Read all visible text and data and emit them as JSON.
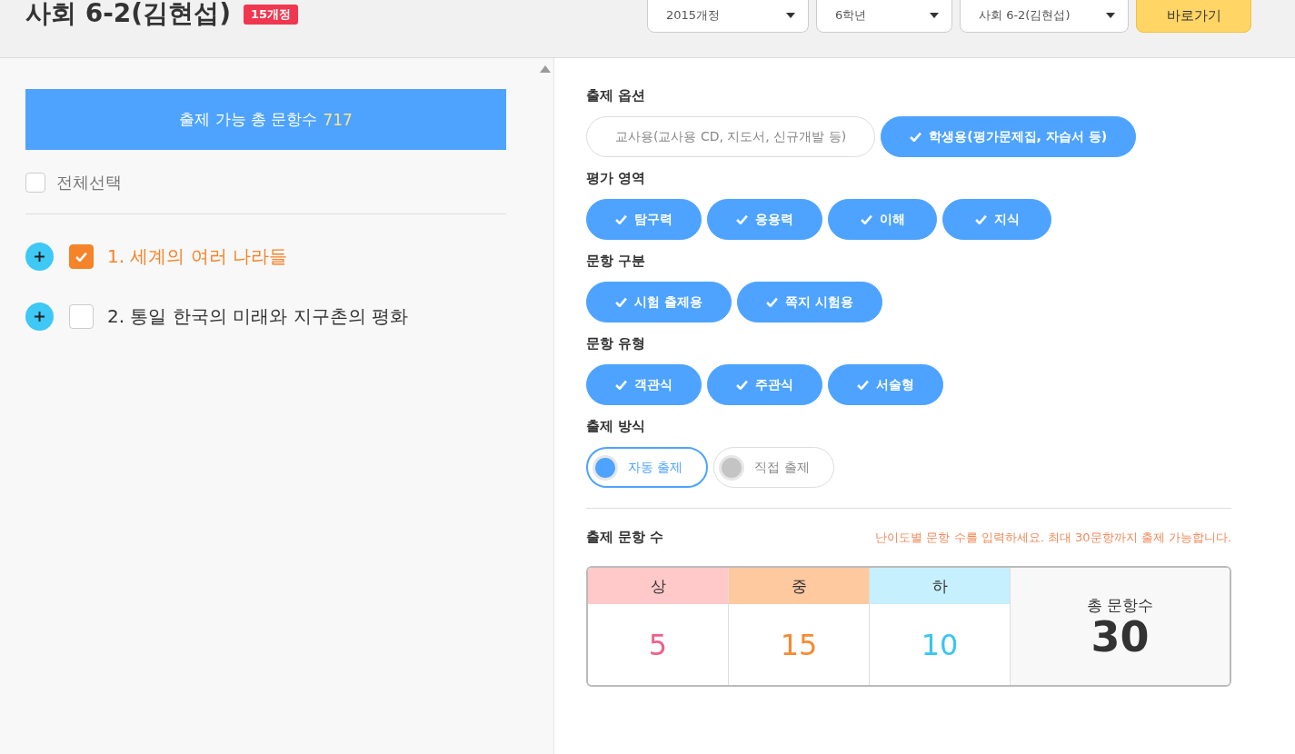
{
  "header": {
    "title": "사회 6-2(김현섭)",
    "badge": "15개정",
    "selects": [
      {
        "value": "2015개정"
      },
      {
        "value": "6학년"
      },
      {
        "value": "사회 6-2(김현섭)"
      }
    ],
    "go_button": "바로가기"
  },
  "left": {
    "total_banner": {
      "label": "출제 가능 총 문항수",
      "count": "717"
    },
    "select_all": {
      "label": "전체선택",
      "checked": false
    },
    "units": [
      {
        "label": "1. 세계의 여러 나라들",
        "checked": true
      },
      {
        "label": "2. 통일 한국의 미래와 지구촌의 평화",
        "checked": false
      }
    ]
  },
  "right": {
    "groups": [
      {
        "title": "출제 옵션",
        "kind": "chips",
        "options": [
          {
            "label": "교사용(교사용 CD, 지도서, 신규개발 등)",
            "selected": false
          },
          {
            "label": "학생용(평가문제집, 자습서 등)",
            "selected": true
          }
        ]
      },
      {
        "title": "평가 영역",
        "kind": "chips",
        "options": [
          {
            "label": "탐구력",
            "selected": true
          },
          {
            "label": "응용력",
            "selected": true
          },
          {
            "label": "이해",
            "selected": true
          },
          {
            "label": "지식",
            "selected": true
          }
        ]
      },
      {
        "title": "문항 구분",
        "kind": "chips",
        "options": [
          {
            "label": "시험 출제용",
            "selected": true
          },
          {
            "label": "쪽지 시험용",
            "selected": true
          }
        ]
      },
      {
        "title": "문항 유형",
        "kind": "chips",
        "options": [
          {
            "label": "객관식",
            "selected": true
          },
          {
            "label": "주관식",
            "selected": true
          },
          {
            "label": "서술형",
            "selected": true
          }
        ]
      },
      {
        "title": "출제 방식",
        "kind": "radio",
        "options": [
          {
            "label": "자동 출제",
            "selected": true
          },
          {
            "label": "직접 출제",
            "selected": false
          }
        ]
      }
    ],
    "count": {
      "title": "출제 문항 수",
      "hint": "난이도별 문항 수를 입력하세요. 최대 30문항까지 출제 가능합니다.",
      "levels": [
        {
          "header": {
            "label": "상",
            "color": "#ffc9c9"
          },
          "count": {
            "value": "5",
            "color": "#f06089"
          }
        },
        {
          "header": {
            "label": "중",
            "color": "#ffc9a0"
          },
          "count": {
            "value": "15",
            "color": "#f58a32"
          }
        },
        {
          "header": {
            "label": "하",
            "color": "#c6f0fd"
          },
          "count": {
            "value": "10",
            "color": "#36c6f0"
          }
        }
      ],
      "total": {
        "label": "총 문항수",
        "value": "30"
      }
    }
  }
}
